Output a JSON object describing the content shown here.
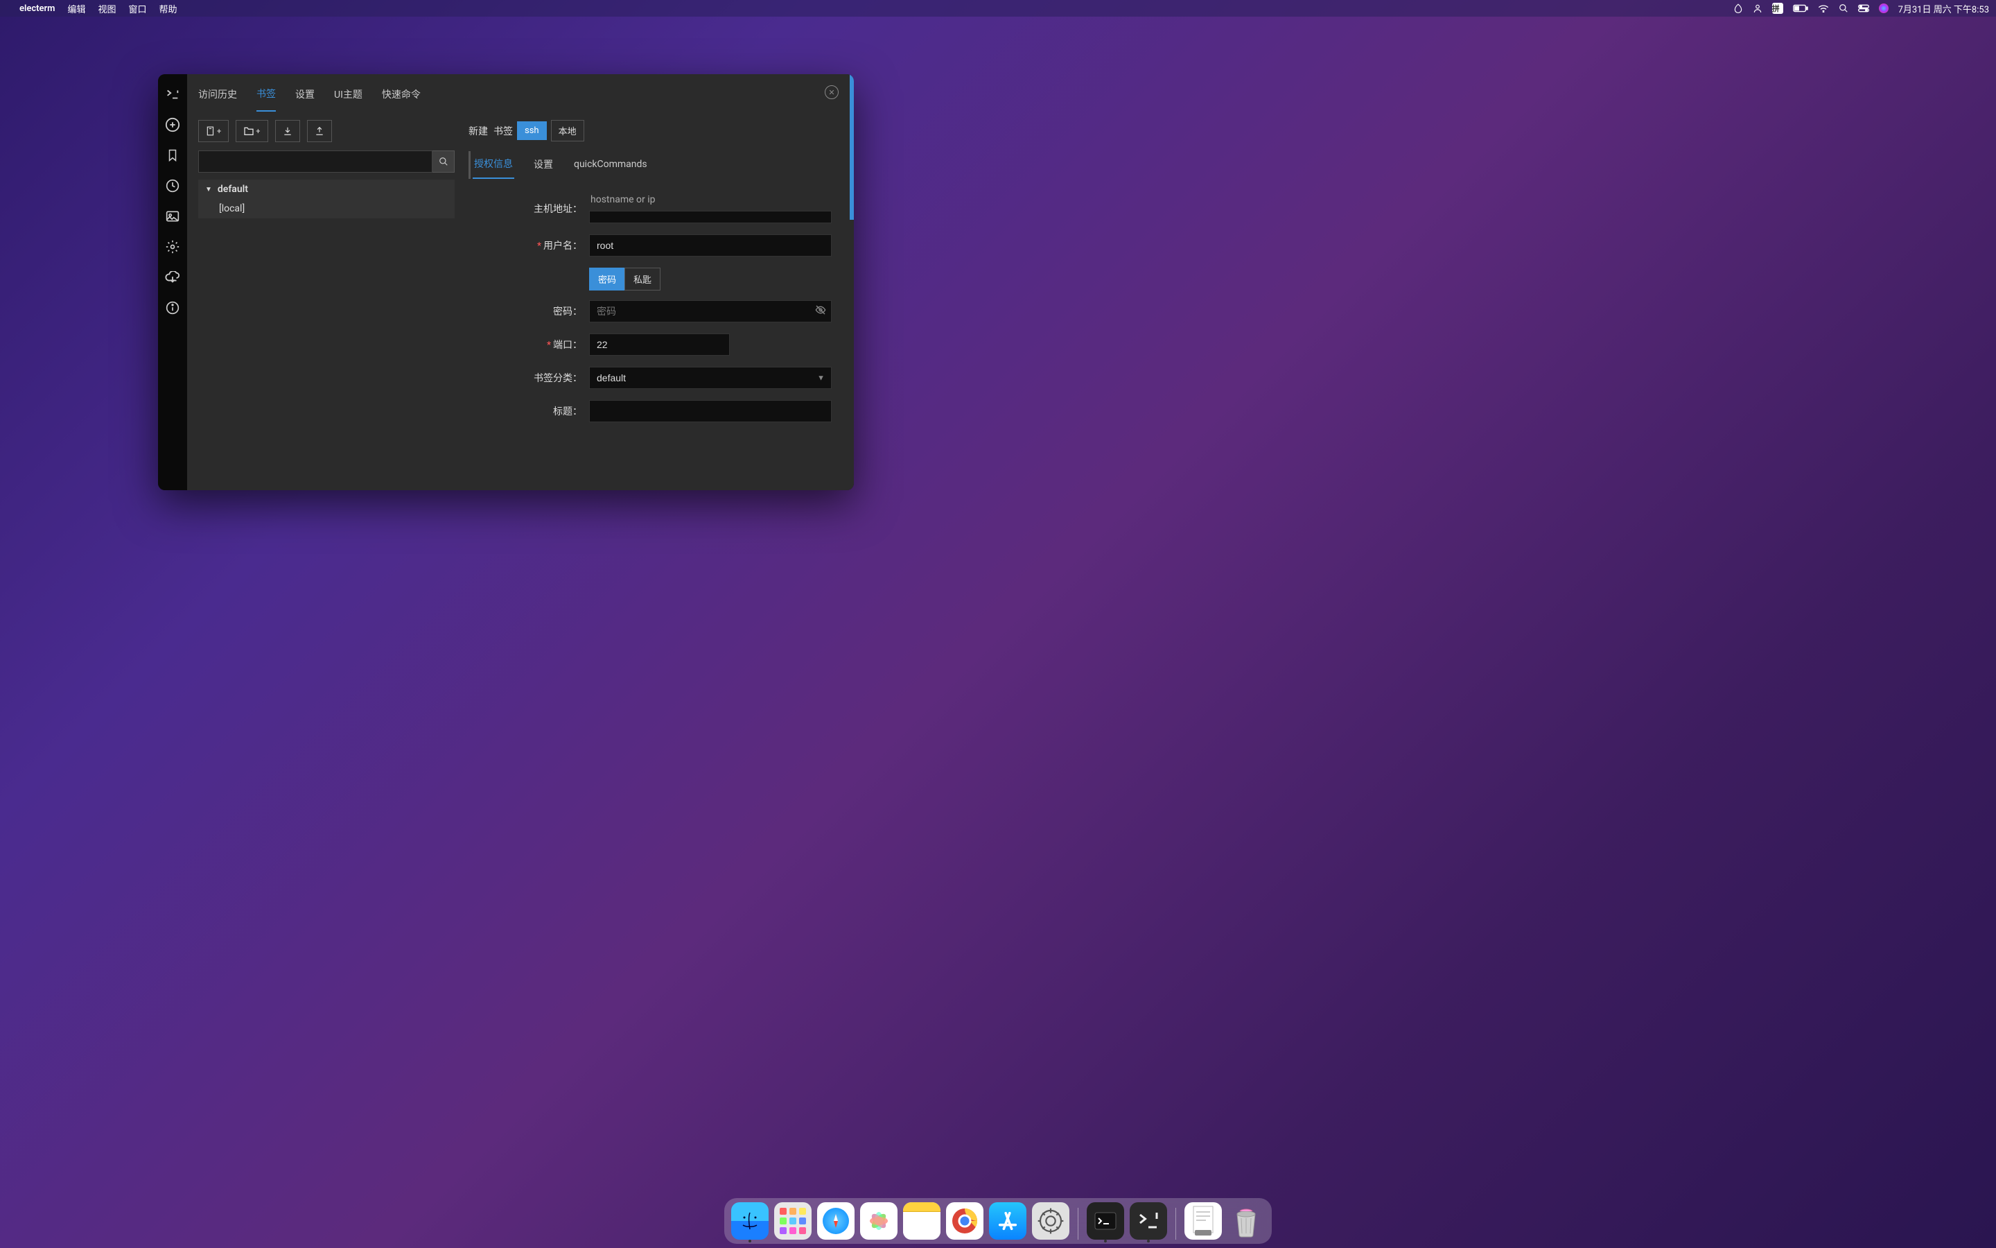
{
  "menubar": {
    "app_name": "electerm",
    "items": [
      "编辑",
      "视图",
      "窗口",
      "帮助"
    ],
    "clock": "7月31日 周六 下午8:53"
  },
  "sidebar_icons": [
    "logo",
    "add",
    "bookmark",
    "history",
    "image",
    "settings",
    "cloud",
    "info"
  ],
  "top_tabs": {
    "items": [
      "访问历史",
      "书签",
      "设置",
      "UI主题",
      "快速命令"
    ],
    "active_index": 1
  },
  "bookmarks": {
    "group_name": "default",
    "children": [
      "[local]"
    ]
  },
  "new_bookmark": {
    "label_prefix": "新建",
    "label_bookmark": "书签",
    "types": [
      "ssh",
      "本地"
    ],
    "type_active_index": 0
  },
  "sub_tabs": {
    "items": [
      "授权信息",
      "设置",
      "quickCommands"
    ],
    "active_index": 0
  },
  "form": {
    "host_label": "主机地址：",
    "host_hint": "hostname or ip",
    "host_value": "",
    "username_label": "用户名：",
    "username_value": "root",
    "auth_options": [
      "密码",
      "私匙"
    ],
    "auth_active_index": 0,
    "password_label": "密码：",
    "password_placeholder": "密码",
    "password_value": "",
    "port_label": "端口：",
    "port_value": "22",
    "category_label": "书签分类：",
    "category_value": "default",
    "title_label": "标题：",
    "title_value": ""
  },
  "dock": {
    "items": [
      "Finder",
      "Launchpad",
      "Safari",
      "Photos",
      "Notes",
      "Chrome",
      "AppStore",
      "Settings"
    ],
    "running": [
      "Terminal",
      "Electerm"
    ],
    "pinned": [
      "TextEdit",
      "Trash"
    ]
  }
}
